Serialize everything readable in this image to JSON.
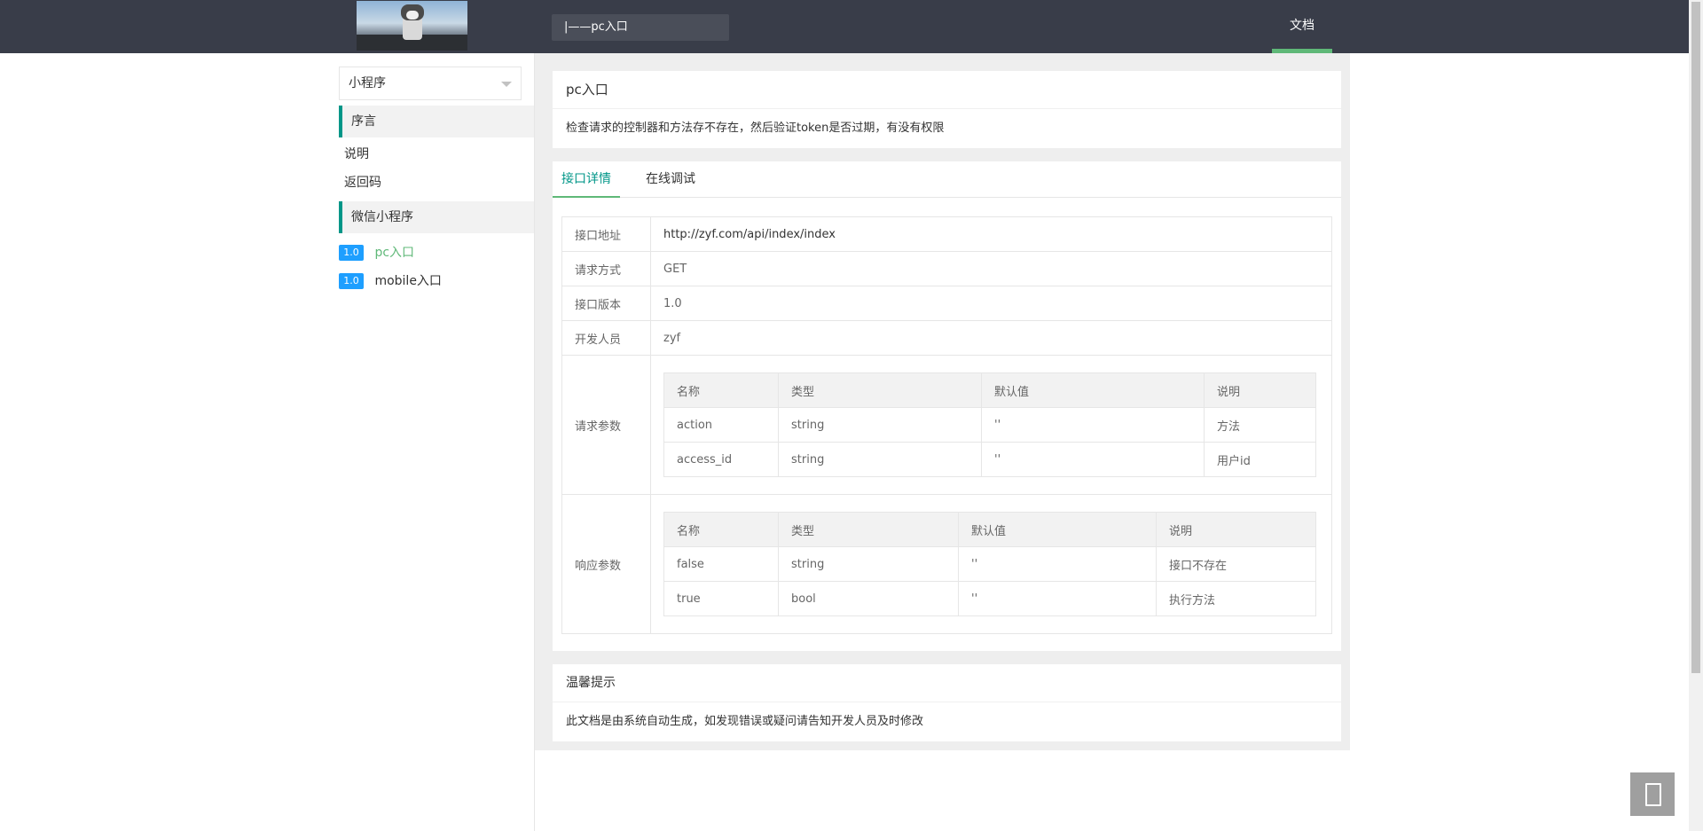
{
  "header": {
    "search_value": "|——pc入口",
    "nav_doc": "文档"
  },
  "sidebar": {
    "select_value": "小程序",
    "group1": "序言",
    "links": [
      "说明",
      "返回码"
    ],
    "group2": "微信小程序",
    "apis": [
      {
        "version": "1.0",
        "label": "pc入口"
      },
      {
        "version": "1.0",
        "label": "mobile入口"
      }
    ]
  },
  "intro": {
    "title": "pc入口",
    "desc": "检查请求的控制器和方法存不存在，然后验证token是否过期，有没有权限"
  },
  "tabs": {
    "detail": "接口详情",
    "online": "在线调试"
  },
  "info": {
    "url_label": "接口地址",
    "url": "http://zyf.com/api/index/index",
    "method_label": "请求方式",
    "method": "GET",
    "version_label": "接口版本",
    "version": "1.0",
    "dev_label": "开发人员",
    "dev": "zyf",
    "req_label": "请求参数",
    "resp_label": "响应参数"
  },
  "req_params": {
    "headers": [
      "名称",
      "类型",
      "默认值",
      "说明"
    ],
    "rows": [
      [
        "action",
        "string",
        "''",
        "方法"
      ],
      [
        "access_id",
        "string",
        "''",
        "用户id"
      ]
    ]
  },
  "resp_params": {
    "headers": [
      "名称",
      "类型",
      "默认值",
      "说明"
    ],
    "rows": [
      [
        "false",
        "string",
        "''",
        "接口不存在"
      ],
      [
        "true",
        "bool",
        "''",
        "执行方法"
      ]
    ]
  },
  "tip": {
    "title": "温馨提示",
    "desc": "此文档是由系统自动生成，如发现错误或疑问请告知开发人员及时修改"
  },
  "colors": {
    "header_bg": "#393D49",
    "accent": "#009688",
    "active_green": "#5FB878",
    "badge_blue": "#1E9FFF"
  }
}
